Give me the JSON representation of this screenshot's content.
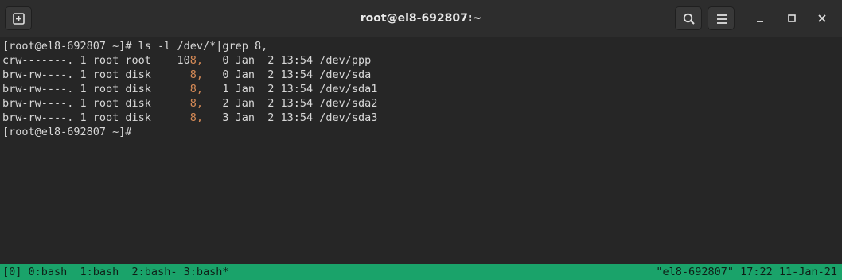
{
  "window": {
    "title": "root@el8-692807:~"
  },
  "icons": {
    "new_tab": "new-tab-icon",
    "search": "search-icon",
    "menu": "hamburger-menu-icon",
    "minimize": "minimize-icon",
    "maximize": "maximize-icon",
    "close": "close-icon"
  },
  "terminal": {
    "command_line": "[root@el8-692807 ~]# ls -l /dev/*|grep 8,",
    "rows": [
      {
        "perm_links_owner": "crw-------. 1 root root    10",
        "match": "8,",
        "rest": "   0 Jan  2 13:54 /dev/ppp"
      },
      {
        "perm_links_owner": "brw-rw----. 1 root disk      ",
        "match": "8,",
        "rest": "   0 Jan  2 13:54 /dev/sda"
      },
      {
        "perm_links_owner": "brw-rw----. 1 root disk      ",
        "match": "8,",
        "rest": "   1 Jan  2 13:54 /dev/sda1"
      },
      {
        "perm_links_owner": "brw-rw----. 1 root disk      ",
        "match": "8,",
        "rest": "   2 Jan  2 13:54 /dev/sda2"
      },
      {
        "perm_links_owner": "brw-rw----. 1 root disk      ",
        "match": "8,",
        "rest": "   3 Jan  2 13:54 /dev/sda3"
      }
    ],
    "prompt": "[root@el8-692807 ~]#"
  },
  "tmux": {
    "windows": "[0] 0:bash  1:bash  2:bash- 3:bash*",
    "right": "\"el8-692807\" 17:22 11-Jan-21"
  },
  "colors": {
    "background": "#262626",
    "text": "#d8d8d8",
    "grep_match": "#d68a56",
    "status_bar": "#1aa36a"
  }
}
